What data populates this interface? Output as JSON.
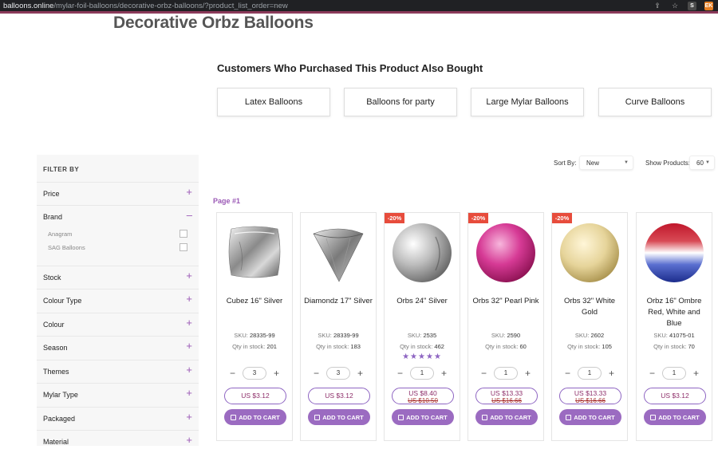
{
  "browser": {
    "domain": "balloons.online",
    "path": "/mylar-foil-balloons/decorative-orbz-balloons/?product_list_order=new",
    "ext1": "S",
    "ext2": "EK"
  },
  "page_title": "Decorative Orbz Balloons",
  "also_bought": {
    "title": "Customers Who Purchased This Product Also Bought",
    "items": [
      "Latex Balloons",
      "Balloons for party",
      "Large Mylar Balloons",
      "Curve Balloons"
    ]
  },
  "toolbar": {
    "sort_label": "Sort By:",
    "sort_value": "New",
    "show_label": "Show Products:",
    "show_value": "60"
  },
  "filters": {
    "title": "FILTER BY",
    "items": [
      "Price",
      "Brand",
      "Stock",
      "Colour Type",
      "Colour",
      "Season",
      "Themes",
      "Mylar Type",
      "Packaged",
      "Material"
    ],
    "brand_options": [
      "Anagram",
      "SAG Balloons"
    ]
  },
  "page_label": "Page #1",
  "products": [
    {
      "name": "Cubez 16\" Silver",
      "sku_label": "SKU:",
      "sku": "28335-99",
      "qty_label": "Qty in stock:",
      "qty": "201",
      "quantity": "3",
      "price": "US $3.12",
      "old_price": "",
      "badge": "",
      "cart": "ADD TO CART",
      "stars": ""
    },
    {
      "name": "Diamondz 17\" Silver",
      "sku_label": "SKU:",
      "sku": "28339-99",
      "qty_label": "Qty in stock:",
      "qty": "183",
      "quantity": "3",
      "price": "US $3.12",
      "old_price": "",
      "badge": "",
      "cart": "ADD TO CART",
      "stars": ""
    },
    {
      "name": "Orbs 24\" Silver",
      "sku_label": "SKU:",
      "sku": "2535",
      "qty_label": "Qty in stock:",
      "qty": "462",
      "quantity": "1",
      "price": "US $8.40",
      "old_price": "US $10.50",
      "badge": "-20%",
      "cart": "ADD TO CART",
      "stars": "★★★★★"
    },
    {
      "name": "Orbs 32\" Pearl Pink",
      "sku_label": "SKU:",
      "sku": "2590",
      "qty_label": "Qty in stock:",
      "qty": "60",
      "quantity": "1",
      "price": "US $13.33",
      "old_price": "US $16.66",
      "badge": "-20%",
      "cart": "ADD TO CART",
      "stars": ""
    },
    {
      "name": "Orbs 32\" White Gold",
      "sku_label": "SKU:",
      "sku": "2602",
      "qty_label": "Qty in stock:",
      "qty": "105",
      "quantity": "1",
      "price": "US $13.33",
      "old_price": "US $16.66",
      "badge": "-20%",
      "cart": "ADD TO CART",
      "stars": ""
    },
    {
      "name": "Orbz 16\" Ombre Red, White and Blue",
      "sku_label": "SKU:",
      "sku": "41075-01",
      "qty_label": "Qty in stock:",
      "qty": "70",
      "quantity": "1",
      "price": "US $3.12",
      "old_price": "",
      "badge": "",
      "cart": "ADD TO CART",
      "stars": ""
    }
  ],
  "colors": {
    "accent": "#9b6bc1",
    "badge": "#e74c3c",
    "price_text": "#8e2f6a"
  }
}
